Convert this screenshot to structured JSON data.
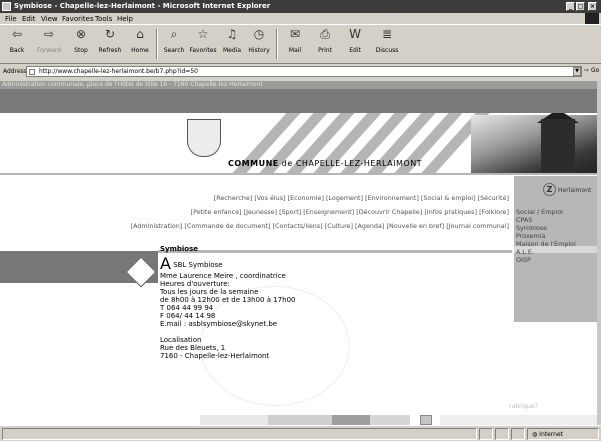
{
  "window": {
    "title": "Symbiose - Chapelle-lez-Herlaimont - Microsoft Internet Explorer",
    "controls": [
      "_",
      "□",
      "×"
    ]
  },
  "menu": [
    "File",
    "Edit",
    "View",
    "Favorites",
    "Tools",
    "Help"
  ],
  "toolbar": {
    "back": "Back",
    "forward": "Forward",
    "stop": "Stop",
    "refresh": "Refresh",
    "home": "Home",
    "search": "Search",
    "favorites": "Favorites",
    "media": "Media",
    "history": "History",
    "mail": "Mail",
    "print": "Print",
    "edit": "Edit",
    "discuss": "Discuss"
  },
  "address": {
    "label": "Address",
    "url": "http://www.chapelle-lez-herlaimont.be/b7.php?id=50",
    "go": "Go"
  },
  "page": {
    "top_line": "Administration communale, place de l'Hôtel de Ville 16 - 7160 Chapelle-lez-Herlaimont",
    "banner_prefix": "COMMUNE",
    "banner_de": "de",
    "banner_name": "CHAPELLE-LEZ-HERLAIMONT",
    "nav_row1": [
      "[Recherche]",
      "[Vos élus]",
      "[Economie]",
      "[Logement]",
      "[Environnement]",
      "[Social & emploi]",
      "[Sécurité]"
    ],
    "nav_row2": [
      "[Petite enfance]",
      "[Jeunesse]",
      "[Sport]",
      "[Enseignement]",
      "[Découvrir Chapelle]",
      "[Infos pratiques]",
      "[Folklore]"
    ],
    "nav_row3": [
      "[Administration]",
      "[Commande de document]",
      "[Contacts/liens]",
      "[Culture]",
      "[Agenda]",
      "[Nouvelle en bref]",
      "[Journal communal]"
    ],
    "right_logo_letter": "Z",
    "right_logo_name": "Herlaimont",
    "right_links": [
      "Social / Emploi",
      "CPAS",
      "Symbiose",
      "Proxemia",
      "Maison de l'Emploi",
      "A.L.E.",
      "OISP"
    ],
    "section_title": "Symbiose",
    "big_letter": "A",
    "content_lines": [
      "SBL Symbiose",
      "Mme Laurence Meire , coordinatrice",
      "Heures d'ouverture:",
      "Tous les jours de la semaine",
      "de 8h00 à 12h00 et de 13h00 à 17h00",
      "T 064 44 99 94",
      "F 064/ 44 14 98",
      "E.mail : asblsymbiose@skynet.be",
      "",
      "Localisation",
      "Rue des Bleuets, 1",
      "7160 - Chapelle-lez-Herlaimont"
    ],
    "rubrique": "rubrique?"
  },
  "status": {
    "zone": "Internet"
  },
  "colors": {
    "title_bar": "#3c3c3c",
    "chrome": "#d4d0c8",
    "side_grey": "#b7b7b7",
    "band_grey": "#7a7a7a"
  }
}
